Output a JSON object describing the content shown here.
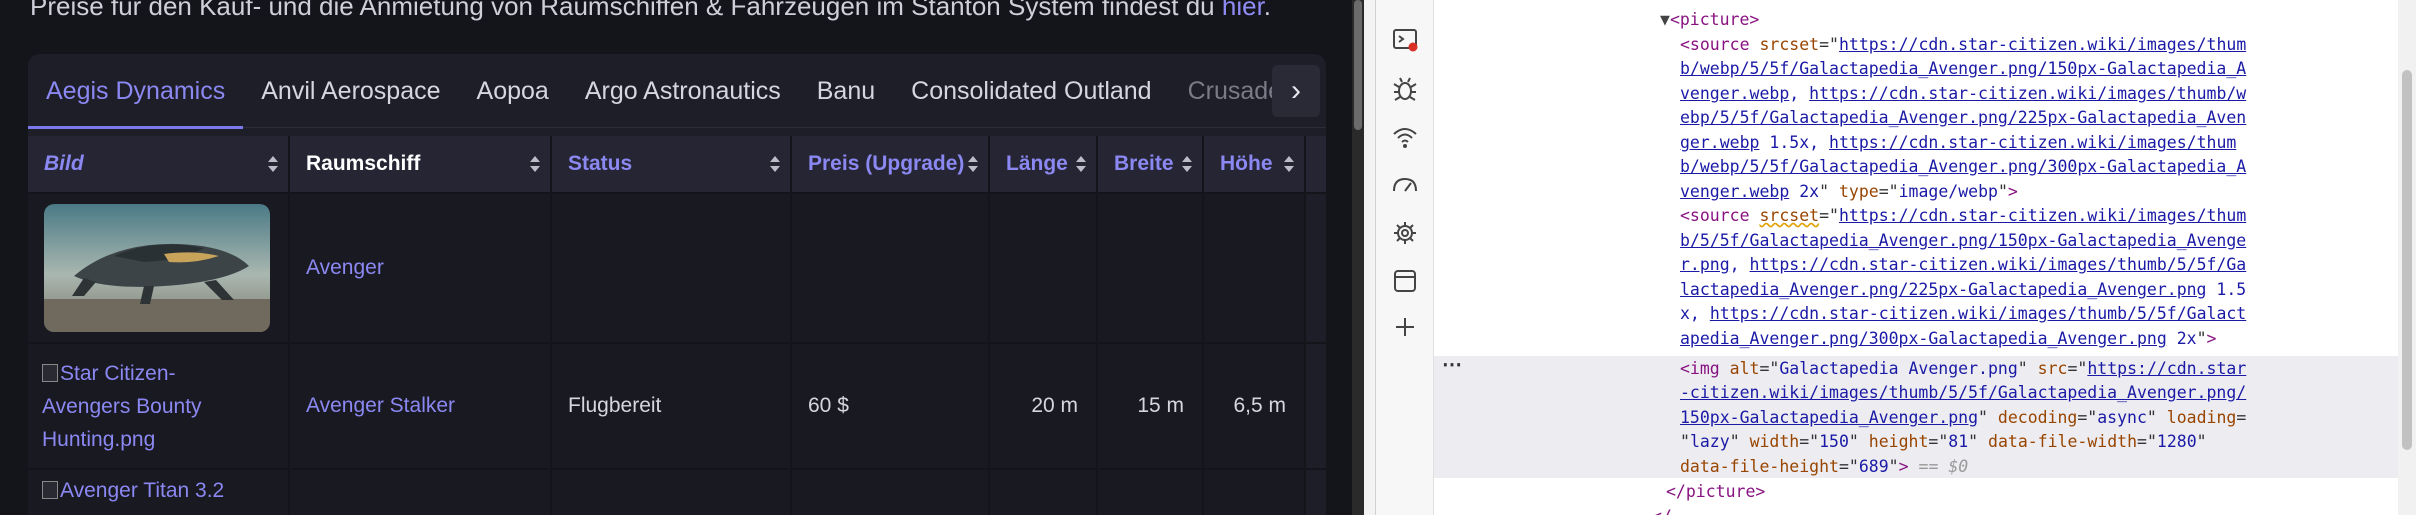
{
  "intro": {
    "text": "Preise für den Kauf- und die Anmietung von Raumschiffen & Fahrzeugen im Stanton System findest du",
    "link": "hier",
    "end": "."
  },
  "tabs": [
    "Aegis Dynamics",
    "Anvil Aerospace",
    "Aopoa",
    "Argo Astronautics",
    "Banu",
    "Consolidated Outland",
    "Crusader I"
  ],
  "tab_next": "›",
  "columns": {
    "bild": "Bild",
    "raumschiff": "Raumschiff",
    "status": "Status",
    "preis": "Preis (Upgrade)",
    "laenge": "Länge",
    "breite": "Breite",
    "hoehe": "Höhe"
  },
  "rows": [
    {
      "bild_alt": "",
      "name": "Avenger",
      "status": "",
      "preis": "",
      "laenge": "",
      "breite": "",
      "hoehe": ""
    },
    {
      "bild_alt": "Star Citizen-Avengers Bounty Hunting.png",
      "name": "Avenger Stalker",
      "status": "Flugbereit",
      "preis": "60 $",
      "laenge": "20 m",
      "breite": "15 m",
      "hoehe": "6,5 m"
    },
    {
      "bild_alt": "Avenger Titan 3.2",
      "name": "",
      "status": "",
      "preis": "",
      "laenge": "",
      "breite": "",
      "hoehe": ""
    }
  ],
  "devtools": {
    "picture_open": "<picture>",
    "picture_close": "</picture>",
    "source1_urls": [
      "https://cdn.star-citizen.wiki/images/thum",
      "b/webp/5/5f/Galactapedia_Avenger.png/150px-Galactapedia_A",
      "venger.webp",
      "https://cdn.star-citizen.wiki/images/thumb/w",
      "ebp/5/5f/Galactapedia_Avenger.png/225px-Galactapedia_Aven",
      "ger.webp",
      "https://cdn.star-citizen.wiki/images/thum",
      "b/webp/5/5f/Galactapedia_Avenger.png/300px-Galactapedia_A",
      "venger.webp"
    ],
    "source2_urls": [
      "https://cdn.star-citizen.wiki/images/thum",
      "b/5/5f/Galactapedia_Avenger.png/150px-Galactapedia_Avenge",
      "r.png",
      "https://cdn.star-citizen.wiki/images/thumb/5/5f/Ga",
      "lactapedia_Avenger.png/225px-Galactapedia_Avenger.png",
      "https://cdn.star-citizen.wiki/images/thumb/5/5f/Galact",
      "apedia_Avenger.png/300px-Galactapedia_Avenger.png"
    ],
    "img_url": [
      "https://cdn.star",
      "-citizen.wiki/images/thumb/5/5f/Galactapedia_Avenger.png/",
      "150px-Galactapedia_Avenger.png"
    ],
    "img_alt": "Galactapedia Avenger.png",
    "dollar0": "== $0"
  }
}
